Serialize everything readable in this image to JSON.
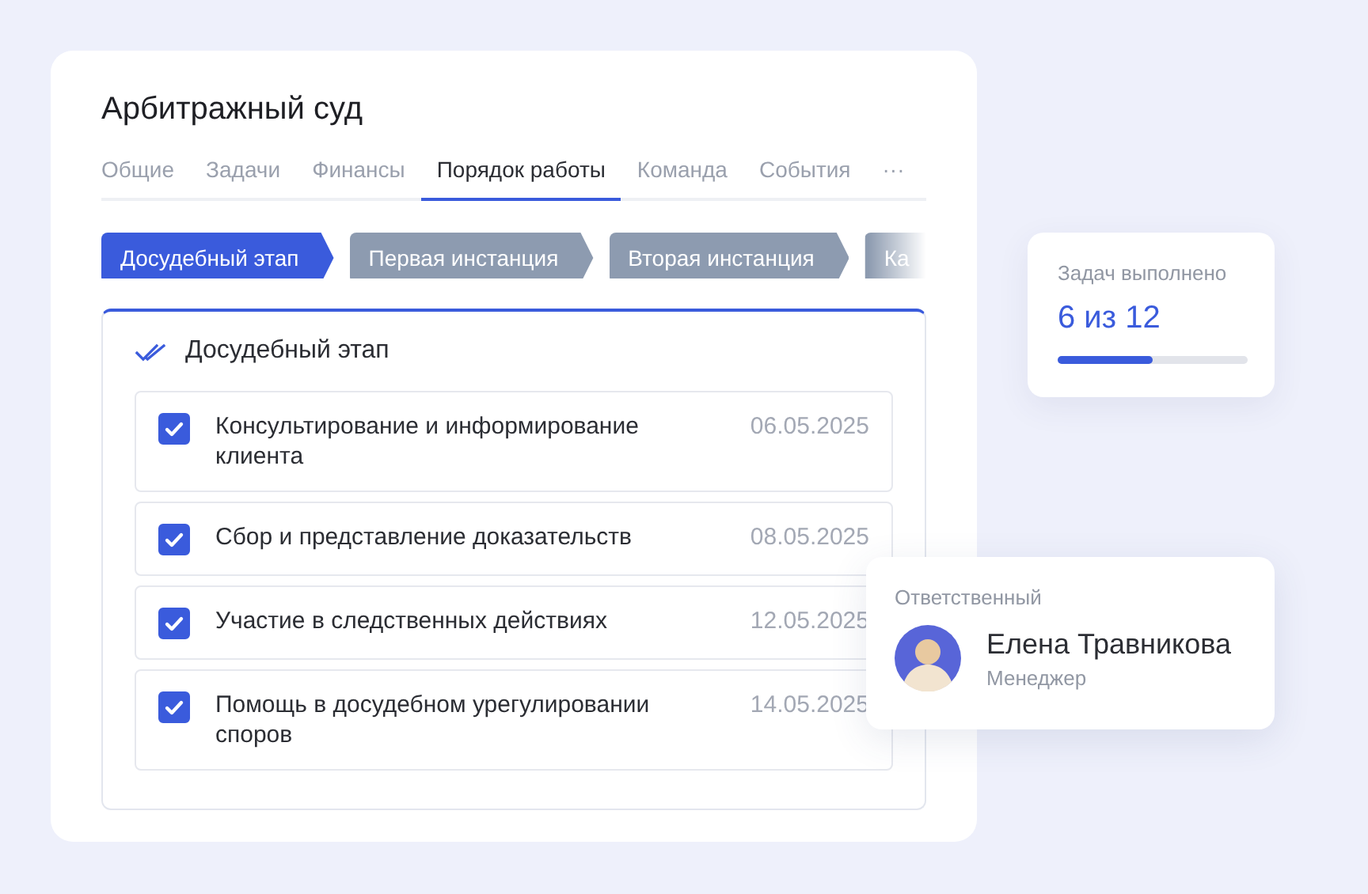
{
  "title": "Арбитражный суд",
  "tabs": [
    {
      "label": "Общие",
      "selected": false
    },
    {
      "label": "Задачи",
      "selected": false
    },
    {
      "label": "Финансы",
      "selected": false
    },
    {
      "label": "Порядок работы",
      "selected": true
    },
    {
      "label": "Команда",
      "selected": false
    },
    {
      "label": "События",
      "selected": false
    },
    {
      "label": "···",
      "selected": false
    }
  ],
  "stages": [
    {
      "label": "Досудебный этап",
      "selected": true
    },
    {
      "label": "Первая инстанция",
      "selected": false
    },
    {
      "label": "Вторая инстанция",
      "selected": false
    },
    {
      "label": "Ка",
      "selected": false
    }
  ],
  "section": {
    "title": "Досудебный этап",
    "tasks": [
      {
        "text": "Консультирование и информирование клиента",
        "date": "06.05.2025",
        "checked": true
      },
      {
        "text": "Сбор и представление доказательств",
        "date": "08.05.2025",
        "checked": true
      },
      {
        "text": "Участие в следственных действиях",
        "date": "12.05.2025",
        "checked": true
      },
      {
        "text": "Помощь в досудебном урегулировании споров",
        "date": "14.05.2025",
        "checked": true
      }
    ]
  },
  "progress": {
    "label": "Задач выполнено",
    "value": "6 из 12",
    "level": 0.5
  },
  "responsible": {
    "label": "Ответственный",
    "name": "Елена Травникова",
    "role": "Менеджер"
  }
}
